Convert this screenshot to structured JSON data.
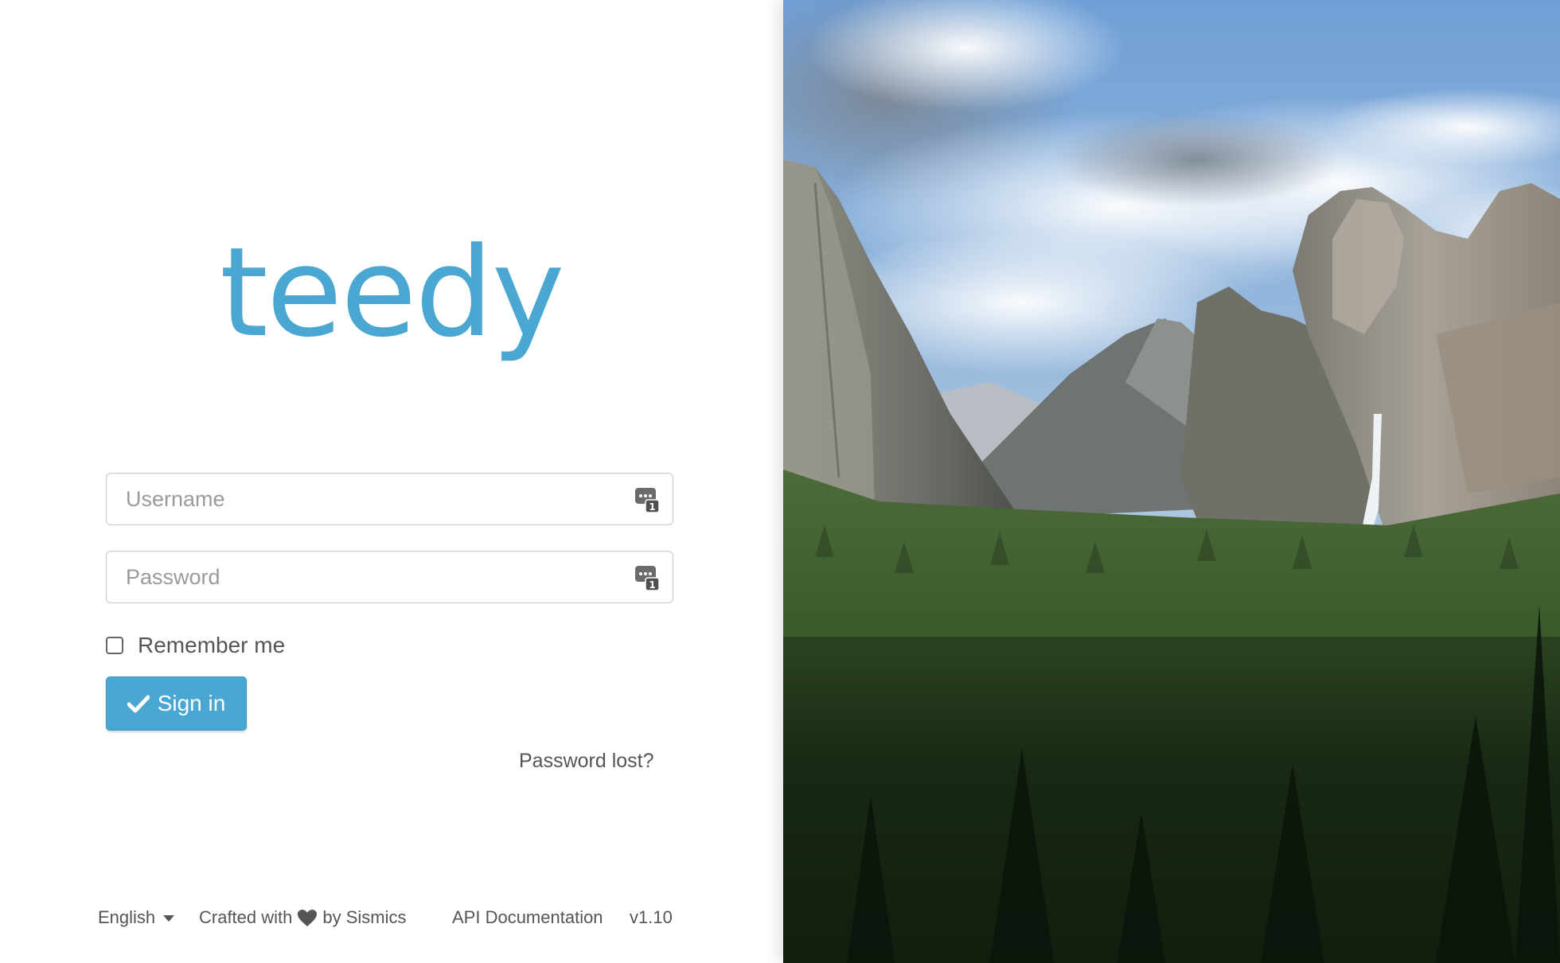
{
  "brand": {
    "logo_text": "teedy",
    "accent_color": "#4aa7d1"
  },
  "login_form": {
    "username_placeholder": "Username",
    "password_placeholder": "Password",
    "remember_label": "Remember me",
    "signin_label": "Sign in",
    "password_lost_label": "Password lost?"
  },
  "icons": {
    "field_icon": "password-manager-icon",
    "signin_icon": "checkmark-icon",
    "language_caret": "caret-down-icon",
    "crafted_heart": "heart-icon"
  },
  "footer": {
    "language": "English",
    "crafted_prefix": "Crafted with",
    "crafted_suffix": "by Sismics",
    "api_docs": "API Documentation",
    "version": "v1.10"
  }
}
